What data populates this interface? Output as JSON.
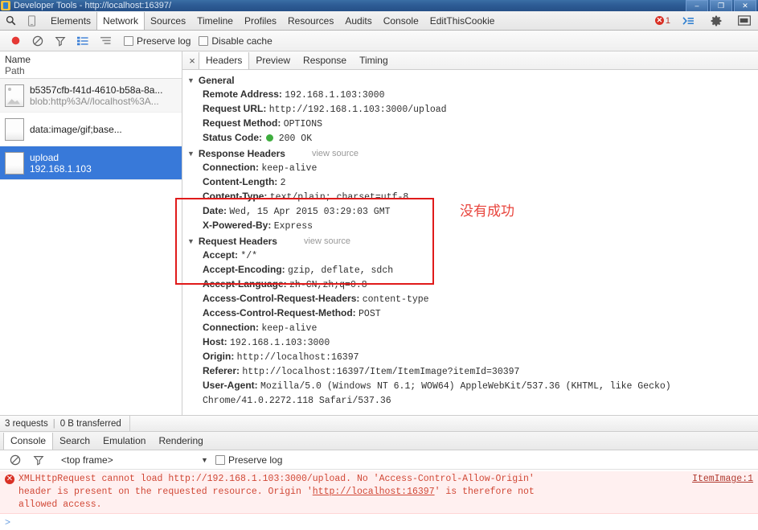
{
  "window": {
    "title": "Developer Tools - http://localhost:16397/",
    "minimize": "–",
    "maximize": "❐",
    "close": "✕"
  },
  "toolbar": {
    "search_icon": "search-icon",
    "device_icon": "device-toggle-icon",
    "tabs": [
      {
        "label": "Elements",
        "active": false
      },
      {
        "label": "Network",
        "active": true
      },
      {
        "label": "Sources",
        "active": false
      },
      {
        "label": "Timeline",
        "active": false
      },
      {
        "label": "Profiles",
        "active": false
      },
      {
        "label": "Resources",
        "active": false
      },
      {
        "label": "Audits",
        "active": false
      },
      {
        "label": "Console",
        "active": false
      },
      {
        "label": "EditThisCookie",
        "active": false
      }
    ],
    "error_count": "1",
    "drawer_icon": "show-drawer-icon",
    "settings_icon": "gear-icon",
    "dock_icon": "dock-side-icon"
  },
  "network_toolbar": {
    "record_label": "record-button",
    "clear_label": "clear-button",
    "filter_label": "filter-button",
    "view_list_label": "view-list-button",
    "view_timeline_label": "view-timeline-button",
    "preserve_log": "Preserve log",
    "disable_cache": "Disable cache"
  },
  "sidebar": {
    "col_name": "Name",
    "col_path": "Path",
    "requests": [
      {
        "name": "b5357cfb-f41d-4610-b58a-8a...",
        "path": "blob:http%3A//localhost%3A...",
        "selected": false
      },
      {
        "name": "data:image/gif;base...",
        "path": "",
        "selected": false
      },
      {
        "name": "upload",
        "path": "192.168.1.103",
        "selected": true
      }
    ]
  },
  "details": {
    "close_label": "×",
    "tabs": [
      {
        "label": "Headers",
        "active": true
      },
      {
        "label": "Preview",
        "active": false
      },
      {
        "label": "Response",
        "active": false
      },
      {
        "label": "Timing",
        "active": false
      }
    ],
    "general": {
      "title": "General",
      "rows": [
        {
          "key": "Remote Address:",
          "value": "192.168.1.103:3000"
        },
        {
          "key": "Request URL:",
          "value": "http://192.168.1.103:3000/upload"
        },
        {
          "key": "Request Method:",
          "value": "OPTIONS"
        },
        {
          "key": "Status Code:",
          "value": "200 OK",
          "status_dot": true
        }
      ]
    },
    "response_headers": {
      "title": "Response Headers",
      "view_source": "view source",
      "rows": [
        {
          "key": "Connection:",
          "value": "keep-alive"
        },
        {
          "key": "Content-Length:",
          "value": "2"
        },
        {
          "key": "Content-Type:",
          "value": "text/plain; charset=utf-8"
        },
        {
          "key": "Date:",
          "value": "Wed, 15 Apr 2015 03:29:03 GMT"
        },
        {
          "key": "X-Powered-By:",
          "value": "Express"
        }
      ]
    },
    "request_headers": {
      "title": "Request Headers",
      "view_source": "view source",
      "rows": [
        {
          "key": "Accept:",
          "value": "*/*"
        },
        {
          "key": "Accept-Encoding:",
          "value": "gzip, deflate, sdch"
        },
        {
          "key": "Accept-Language:",
          "value": "zh-CN,zh;q=0.8"
        },
        {
          "key": "Access-Control-Request-Headers:",
          "value": "content-type"
        },
        {
          "key": "Access-Control-Request-Method:",
          "value": "POST"
        },
        {
          "key": "Connection:",
          "value": "keep-alive"
        },
        {
          "key": "Host:",
          "value": "192.168.1.103:3000"
        },
        {
          "key": "Origin:",
          "value": "http://localhost:16397"
        },
        {
          "key": "Referer:",
          "value": "http://localhost:16397/Item/ItemImage?itemId=30397"
        },
        {
          "key": "User-Agent:",
          "value": "Mozilla/5.0 (Windows NT 6.1; WOW64) AppleWebKit/537.36 (KHTML, like Gecko) Chrome/41.0.2272.118 Safari/537.36"
        }
      ]
    }
  },
  "annotation": {
    "text": "没有成功",
    "box_color": "#e01b1b",
    "text_color": "#e8443c"
  },
  "network_status": {
    "requests": "3 requests",
    "separator": "|",
    "transferred": "0 B transferred"
  },
  "drawer": {
    "tabs": [
      {
        "label": "Console",
        "active": true
      },
      {
        "label": "Search",
        "active": false
      },
      {
        "label": "Emulation",
        "active": false
      },
      {
        "label": "Rendering",
        "active": false
      }
    ],
    "clear_icon": "clear-console-icon",
    "filter_icon": "filter-icon",
    "frame_selector": "<top frame>",
    "caret": "▼",
    "preserve_log": "Preserve log",
    "messages": [
      {
        "level": "error",
        "icon": "error-icon",
        "text_part1": "XMLHttpRequest cannot load http://192.168.1.103:3000/upload. No 'Access-Control-Allow-Origin' header is present on the requested resource. Origin '",
        "link": "http://localhost:16397",
        "text_part2": "' is therefore not allowed access.",
        "source": "ItemImage:1"
      }
    ],
    "prompt_caret": ">"
  }
}
